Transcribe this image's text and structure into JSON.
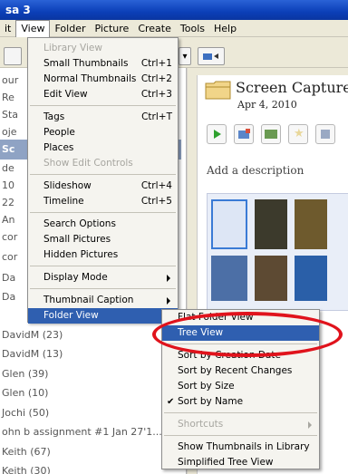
{
  "window": {
    "title": "sa 3"
  },
  "menubar": {
    "items": [
      "it",
      "View",
      "Folder",
      "Picture",
      "Create",
      "Tools",
      "Help"
    ]
  },
  "view_menu": {
    "items": [
      {
        "label": "Library View",
        "shortcut": "",
        "disabled": true
      },
      {
        "label": "Small Thumbnails",
        "shortcut": "Ctrl+1"
      },
      {
        "label": "Normal Thumbnails",
        "shortcut": "Ctrl+2"
      },
      {
        "label": "Edit View",
        "shortcut": "Ctrl+3"
      },
      {
        "label": "Tags",
        "shortcut": "Ctrl+T"
      },
      {
        "label": "People",
        "shortcut": ""
      },
      {
        "label": "Places",
        "shortcut": ""
      },
      {
        "label": "Show Edit Controls",
        "shortcut": "",
        "disabled": true
      },
      {
        "label": "Slideshow",
        "shortcut": "Ctrl+4"
      },
      {
        "label": "Timeline",
        "shortcut": "Ctrl+5"
      },
      {
        "label": "Search Options",
        "shortcut": ""
      },
      {
        "label": "Small Pictures",
        "shortcut": ""
      },
      {
        "label": "Hidden Pictures",
        "shortcut": ""
      },
      {
        "label": "Display Mode",
        "shortcut": ""
      },
      {
        "label": "Thumbnail Caption",
        "shortcut": ""
      },
      {
        "label": "Folder View",
        "shortcut": ""
      }
    ]
  },
  "folder_submenu": {
    "items": [
      {
        "label": "Flat Folder View"
      },
      {
        "label": "Tree View"
      },
      {
        "label": "Sort by Creation Date"
      },
      {
        "label": "Sort by Recent Changes"
      },
      {
        "label": "Sort by Size"
      },
      {
        "label": "Sort by Name",
        "checked": true
      },
      {
        "label": "Shortcuts",
        "disabled": true
      },
      {
        "label": "Show Thumbnails in Library"
      },
      {
        "label": "Simplified Tree View"
      }
    ]
  },
  "left_pane": {
    "rows": [
      "our",
      "Re",
      "Sta",
      "oje",
      "Sc",
      "de",
      "10",
      "22",
      "An",
      "cor",
      "cor",
      "Da",
      "Da",
      "DavidM (23)",
      "DavidM (13)",
      "Glen (39)",
      "Glen (10)",
      "Jochi (50)",
      "ohn b assignment #1 Jan 27'1...",
      "Keith (67)",
      "Keith (30)"
    ]
  },
  "right_pane": {
    "folder_title": "Screen Captures",
    "date": "Apr 4, 2010",
    "description_placeholder": "Add a description"
  },
  "colors": {
    "highlight": "#2f5fb0",
    "annotation": "#e0131c"
  }
}
